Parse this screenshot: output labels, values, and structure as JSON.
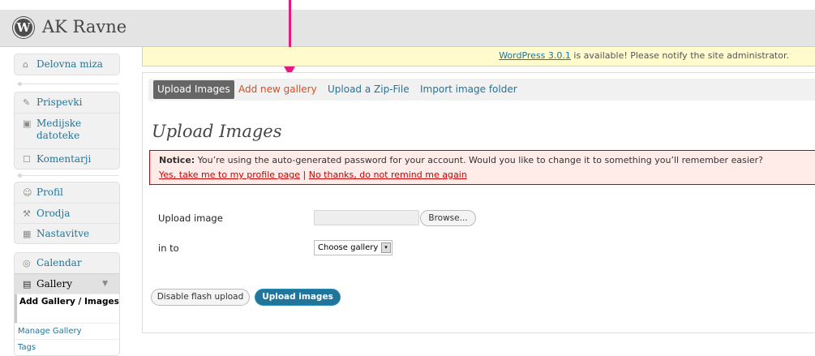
{
  "header": {
    "logo_letter": "W",
    "site_title": "AK Ravne"
  },
  "sidebar": {
    "group1": [
      {
        "icon": "⌂",
        "label": "Delovna miza"
      }
    ],
    "group2": [
      {
        "icon": "✎",
        "label": "Prispevki"
      },
      {
        "icon": "▣",
        "label": "Medijske datoteke"
      },
      {
        "icon": "☐",
        "label": "Komentarji"
      }
    ],
    "group3": [
      {
        "icon": "☺",
        "label": "Profil"
      },
      {
        "icon": "⚒",
        "label": "Orodja"
      },
      {
        "icon": "▦",
        "label": "Nastavitve"
      }
    ],
    "group4": {
      "calendar": {
        "icon": "◎",
        "label": "Calendar"
      },
      "gallery": {
        "icon": "▤",
        "label": "Gallery",
        "toggle": "▼"
      },
      "submenu": [
        "Add Gallery / Images",
        "Manage Gallery",
        "Tags"
      ]
    }
  },
  "update_nag": {
    "link": "WordPress 3.0.1",
    "text": " is available! Please notify the site administrator."
  },
  "tabs": [
    "Upload Images",
    "Add new gallery",
    "Upload a Zip-File",
    "Import image folder"
  ],
  "page_title": "Upload Images",
  "notice": {
    "label": "Notice:",
    "message": " You’re using the auto-generated password for your account. Would you like to change it to something you’ll remember easier?",
    "link_yes": "Yes, take me to my profile page",
    "separator": " | ",
    "link_no": "No thanks, do not remind me again"
  },
  "form": {
    "upload_label": "Upload image",
    "browse_label": "Browse...",
    "into_label": "in to",
    "gallery_select": "Choose gallery",
    "select_arrow": "▾"
  },
  "buttons": {
    "disable_flash": "Disable flash upload",
    "upload": "Upload images"
  },
  "colors": {
    "accent": "#21759b",
    "active_tab_text": "#d54e21",
    "arrow": "#e6197e",
    "notice_bg": "#ffebe8",
    "nag_bg": "#fffbcc"
  }
}
